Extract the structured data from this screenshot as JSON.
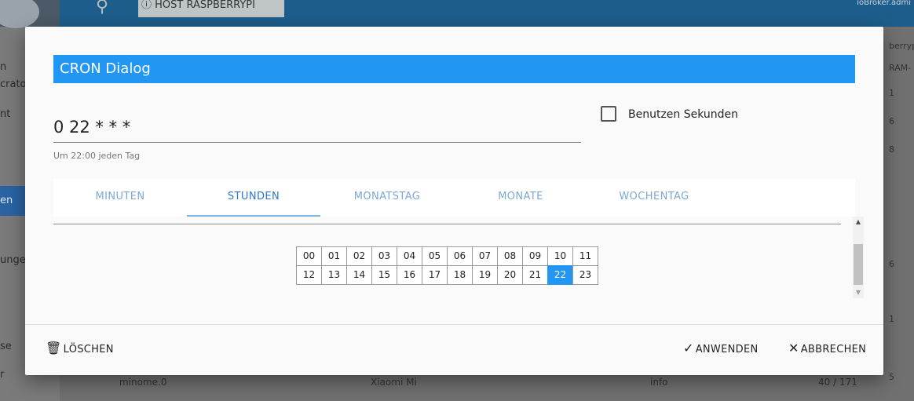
{
  "background": {
    "host_button": "HOST RASPBERRYPI",
    "user": "ioBroker.admi",
    "sidebar_fragments": [
      "n",
      "crator",
      "nt",
      "en",
      "unge",
      "se",
      "r"
    ],
    "right_fragments": [
      "berrypi",
      "RAM-",
      "1",
      "6",
      "8",
      "6",
      "1",
      "5"
    ],
    "row_fragments": [
      "minome.0",
      "Xiaomi Mi",
      "info",
      "40 / 171"
    ]
  },
  "dialog": {
    "title": "CRON Dialog",
    "cron_value": "0 22 * * *",
    "cron_description": "Um 22:00 jeden Tag",
    "use_seconds_label": "Benutzen Sekunden",
    "tabs": [
      "MINUTEN",
      "STUNDEN",
      "MONATSTAG",
      "MONATE",
      "WOCHENTAG"
    ],
    "active_tab": "STUNDEN",
    "hours": [
      "00",
      "01",
      "02",
      "03",
      "04",
      "05",
      "06",
      "07",
      "08",
      "09",
      "10",
      "11",
      "12",
      "13",
      "14",
      "15",
      "16",
      "17",
      "18",
      "19",
      "20",
      "21",
      "22",
      "23"
    ],
    "selected_hour": "22",
    "buttons": {
      "delete": "LÖSCHEN",
      "apply": "ANWENDEN",
      "cancel": "ABBRECHEN"
    }
  },
  "colors": {
    "accent": "#2196f3",
    "tab_text": "#7ea7d4"
  },
  "icons": {
    "delete": "trash-icon",
    "apply": "check-icon",
    "cancel": "close-icon",
    "search": "search-icon"
  }
}
